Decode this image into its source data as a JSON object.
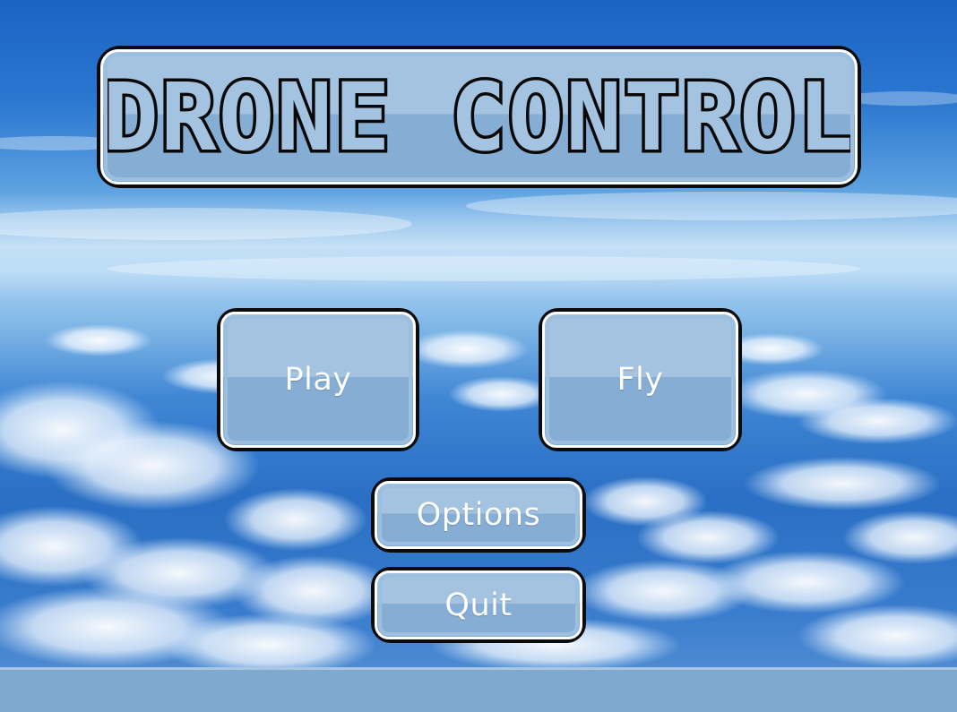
{
  "title": "DRONE CONTROL",
  "menu": {
    "play_label": "Play",
    "fly_label": "Fly",
    "options_label": "Options",
    "quit_label": "Quit"
  },
  "colors": {
    "panel_fill_top": "#a3c3e0",
    "panel_fill_bottom": "#86aed4",
    "panel_border": "#0b0b0b",
    "panel_highlight": "#ffffff",
    "sky_top": "#1c63c4",
    "sky_horizon": "#a8d2f3",
    "bottom_bar": "#7fa9cf"
  }
}
